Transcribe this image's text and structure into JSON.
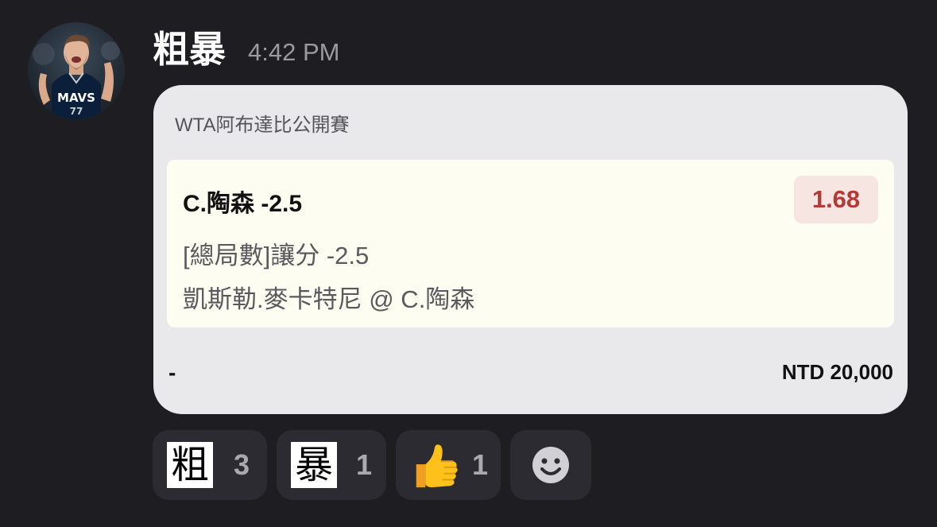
{
  "message": {
    "sender": "粗暴",
    "timestamp": "4:42 PM",
    "avatar_icon": "player-avatar",
    "avatar_jersey_text": "MAVS"
  },
  "bet_card": {
    "tournament": "WTA阿布達比公開賽",
    "selection": "C.陶森 -2.5",
    "odds": "1.68",
    "market": "[總局數]讓分 -2.5",
    "match": "凱斯勒.麥卡特尼 @ C.陶森",
    "stake_label": "-",
    "stake_amount": "NTD 20,000"
  },
  "reactions": [
    {
      "emoji": "粗",
      "count": "3"
    },
    {
      "emoji": "暴",
      "count": "1"
    },
    {
      "emoji": "thumbs-up",
      "count": "1"
    }
  ],
  "add_reaction_icon": "smiley-icon",
  "colors": {
    "background": "#1e1d22",
    "card": "#e9e9ec",
    "bet_box": "#fdfdf1",
    "odds_text": "#b33a37",
    "odds_bg": "#f6e5e1",
    "reaction_bg": "#2c2b31"
  }
}
